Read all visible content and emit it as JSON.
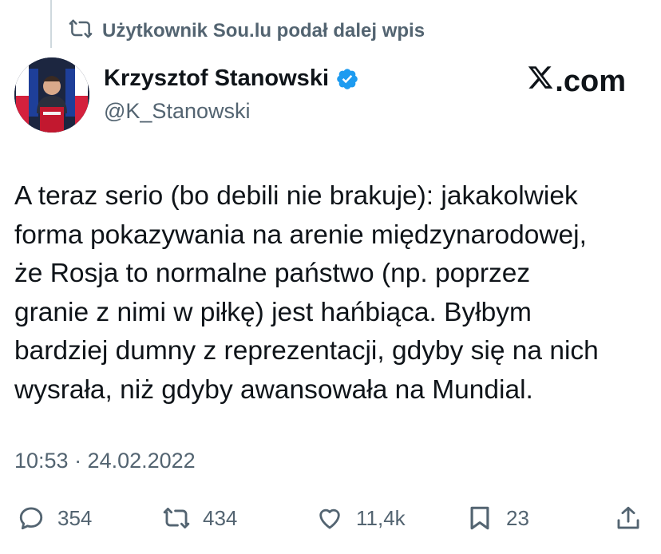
{
  "repost_banner": {
    "text": "Użytkownik Sou.lu podał dalej wpis",
    "icon": "repost-icon"
  },
  "author": {
    "name": "Krzysztof Stanowski",
    "handle": "@K_Stanowski",
    "verified": true,
    "avatar_icon": "avatar-photo"
  },
  "brand": {
    "text": ".com",
    "logo": "x-logo-icon"
  },
  "tweet": {
    "text": "A teraz serio (bo debili nie brakuje): jakakolwiek\nforma pokazywania na arenie międzynarodowej,\nże Rosja to normalne państwo (np. poprzez\ngranie z nimi w piłkę) jest hańbiąca. Byłbym\nbardziej dumny z reprezentacji, gdyby się na nich\nwysrała, niż gdyby awansowała na Mundial.",
    "timestamp": "10:53 · 24.02.2022"
  },
  "actions": {
    "replies": "354",
    "reposts": "434",
    "likes": "11,4k",
    "bookmarks": "23"
  },
  "colors": {
    "text": "#0f1419",
    "muted": "#536471",
    "verified": "#1d9bf0"
  }
}
